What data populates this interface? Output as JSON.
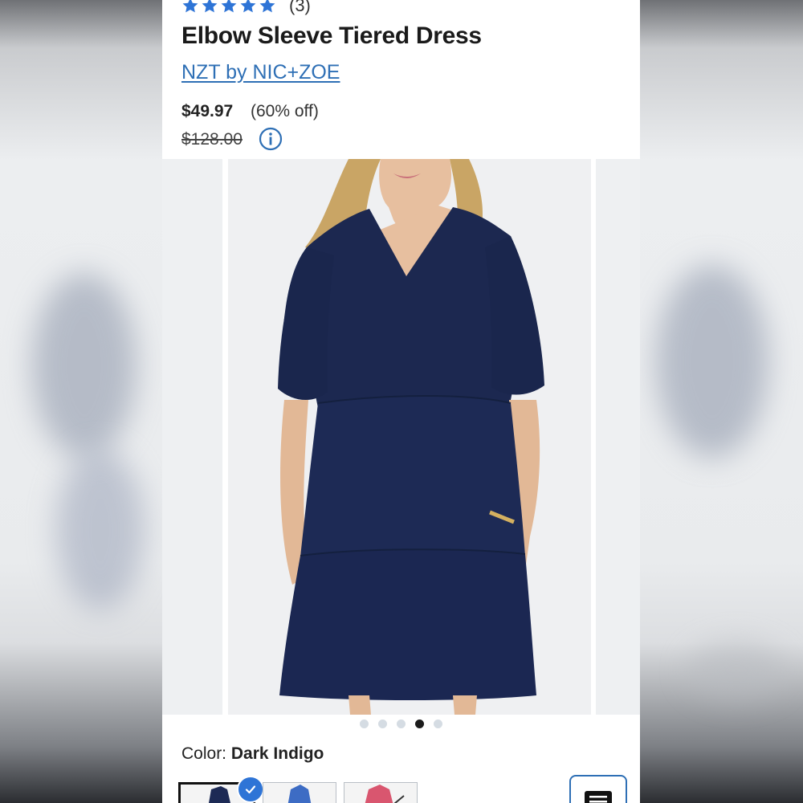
{
  "product": {
    "rating_count": "(3)",
    "title": "Elbow Sleeve Tiered Dress",
    "brand": "NZT by NIC+ZOE",
    "price": "$49.97",
    "discount": "(60% off)",
    "original_price": "$128.00"
  },
  "gallery": {
    "dot_count": 5,
    "active_dot": 4
  },
  "color": {
    "label": "Color:",
    "value": "Dark Indigo"
  },
  "swatches": [
    {
      "name": "Dark Indigo",
      "color": "#1d2a55",
      "selected": true
    },
    {
      "name": "Blue",
      "color": "#3d6cc4",
      "selected": false
    },
    {
      "name": "Pink",
      "color": "#d9566f",
      "selected": false
    }
  ],
  "colors": {
    "accent": "#2e6fb5",
    "star": "#2e74d6",
    "dress": "#1c2850"
  },
  "icons": [
    "star-icon",
    "info-icon",
    "check-icon",
    "menu-icon"
  ]
}
